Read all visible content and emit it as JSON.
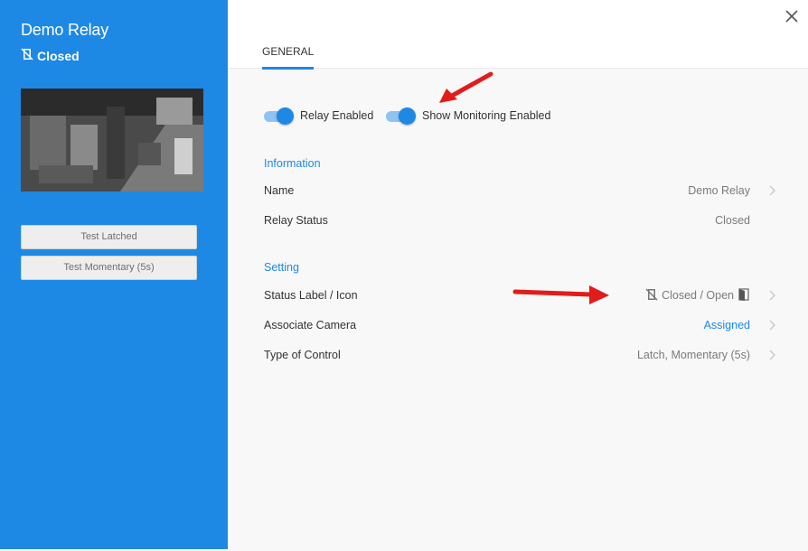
{
  "sidebar": {
    "title": "Demo Relay",
    "status": "Closed",
    "buttons": {
      "test_latched": "Test Latched",
      "test_momentary": "Test Momentary (5s)"
    }
  },
  "header": {
    "tab": "GENERAL"
  },
  "toggles": {
    "relay_enabled": "Relay Enabled",
    "monitoring_enabled": "Show Monitoring Enabled"
  },
  "information": {
    "title": "Information",
    "rows": [
      {
        "label": "Name",
        "value": "Demo Relay"
      },
      {
        "label": "Relay Status",
        "value": "Closed"
      }
    ]
  },
  "setting": {
    "title": "Setting",
    "rows": [
      {
        "label": "Status Label / Icon",
        "value": "Closed / Open"
      },
      {
        "label": "Associate Camera",
        "value": "Assigned"
      },
      {
        "label": "Type of Control",
        "value": "Latch, Momentary (5s)"
      }
    ]
  },
  "colors": {
    "accent": "#1e88e5",
    "arrow": "#e21b1b"
  },
  "icons": [
    "door-closed-icon",
    "door-open-icon",
    "close-icon",
    "chevron-right-icon"
  ]
}
